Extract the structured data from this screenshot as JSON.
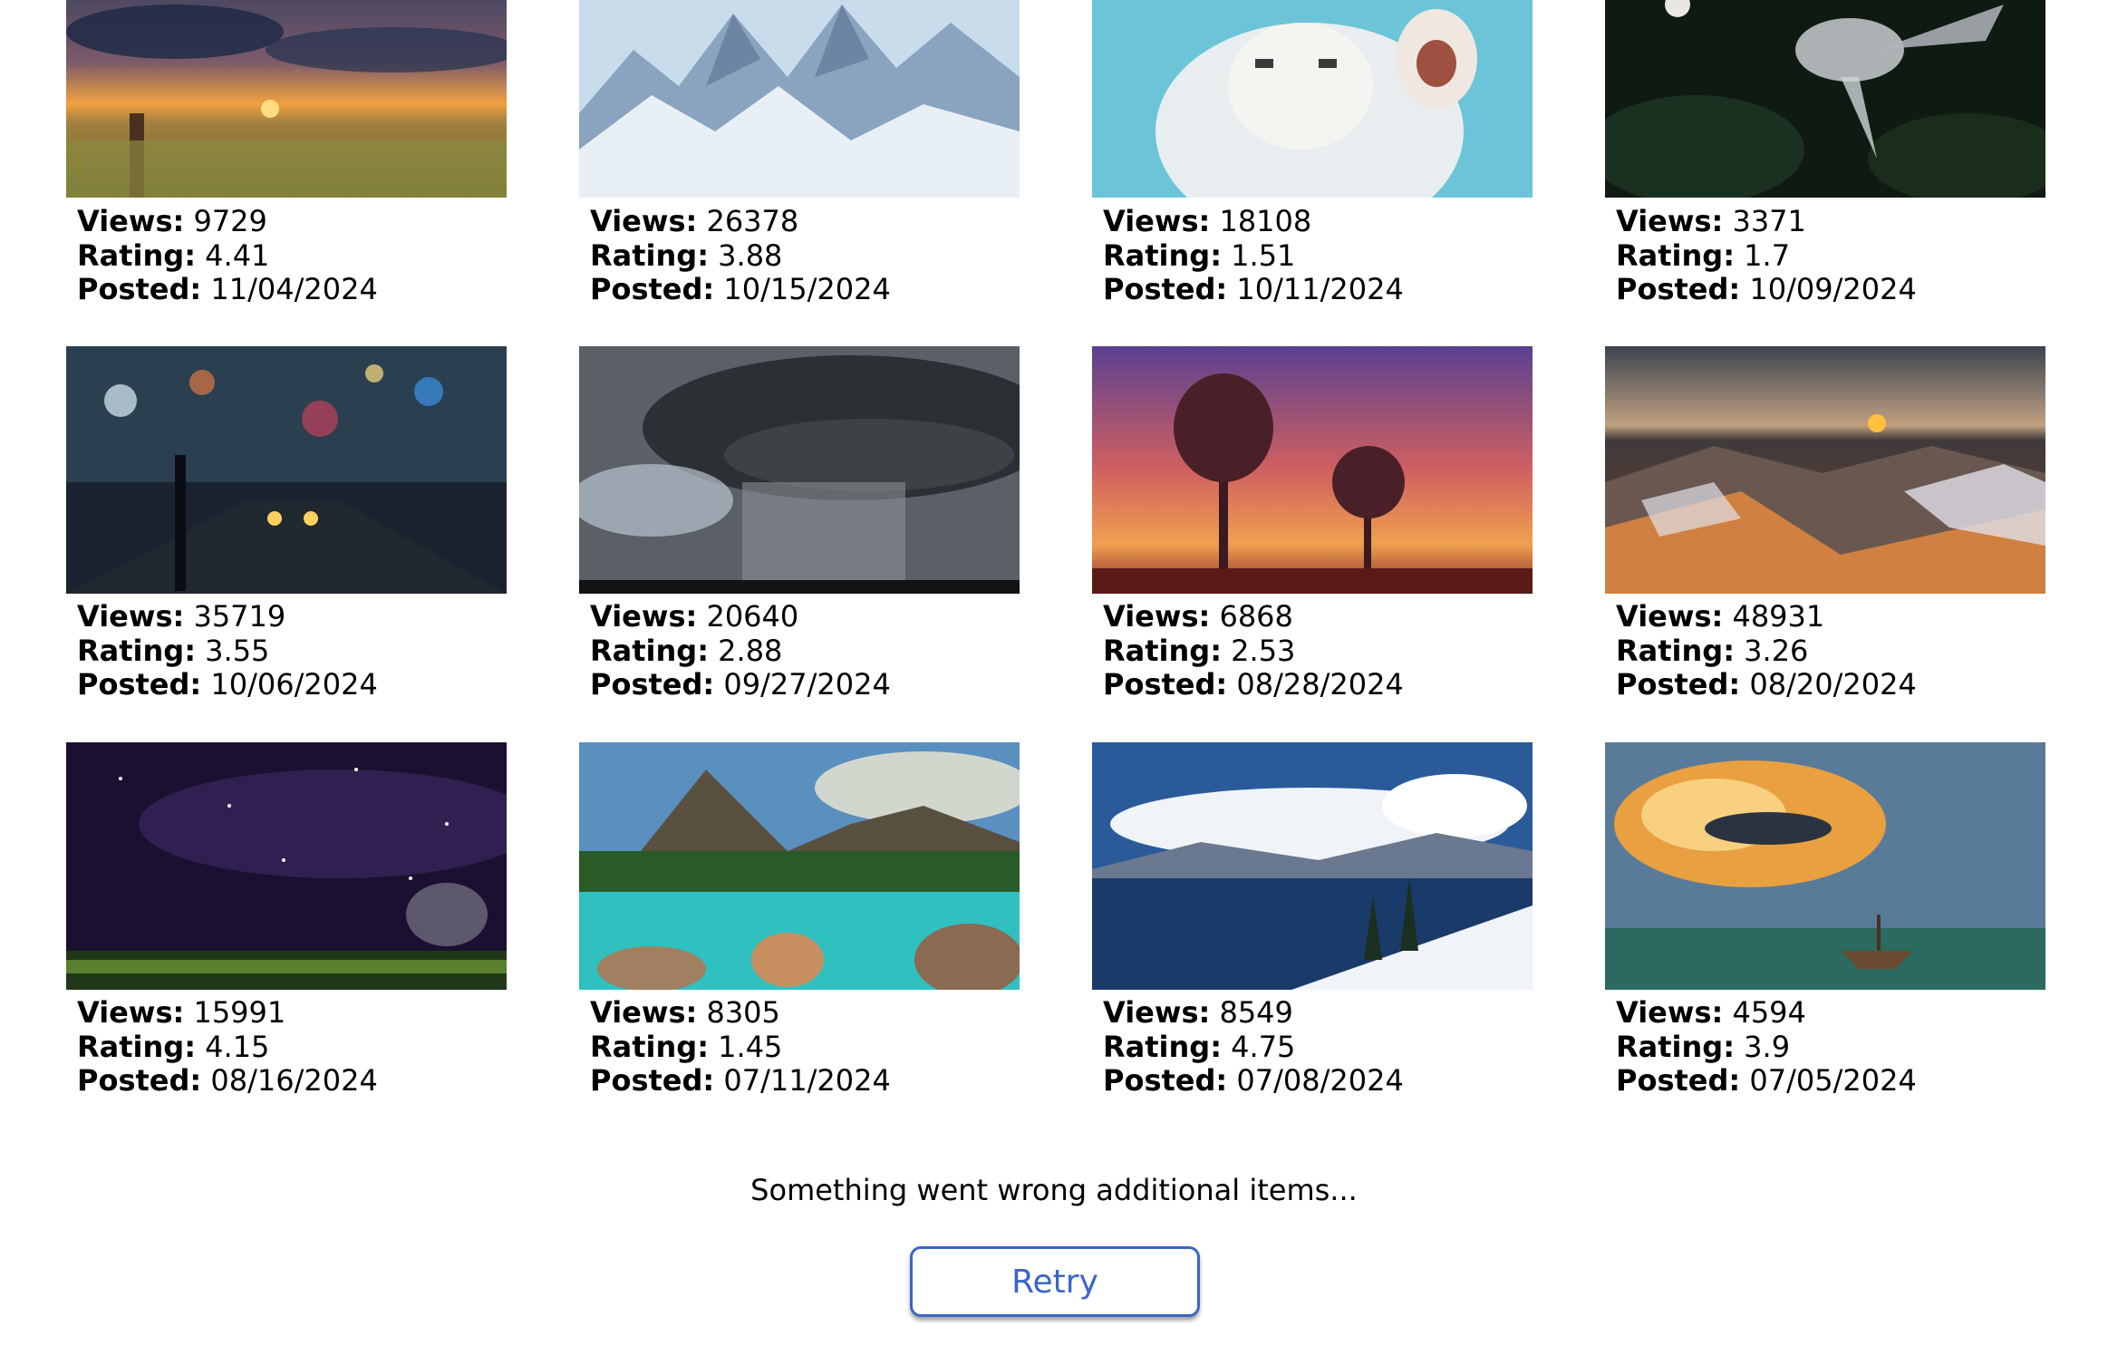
{
  "gallery": {
    "labels": {
      "views": "Views:",
      "rating": "Rating:",
      "posted": "Posted:"
    },
    "items": [
      {
        "views": "9729",
        "rating": "4.41",
        "posted": "11/04/2024",
        "scene": "prairie-sunset"
      },
      {
        "views": "26378",
        "rating": "3.88",
        "posted": "10/15/2024",
        "scene": "snowy-mountains"
      },
      {
        "views": "18108",
        "rating": "1.51",
        "posted": "10/11/2024",
        "scene": "white-tiger-underwater"
      },
      {
        "views": "3371",
        "rating": "1.7",
        "posted": "10/09/2024",
        "scene": "crystal-hummingbird"
      },
      {
        "views": "35719",
        "rating": "3.55",
        "posted": "10/06/2024",
        "scene": "city-street-night"
      },
      {
        "views": "20640",
        "rating": "2.88",
        "posted": "09/27/2024",
        "scene": "supercell-storm"
      },
      {
        "views": "6868",
        "rating": "2.53",
        "posted": "08/28/2024",
        "scene": "anime-sunset-trees"
      },
      {
        "views": "48931",
        "rating": "3.26",
        "posted": "08/20/2024",
        "scene": "canyon-sunrise"
      },
      {
        "views": "15991",
        "rating": "4.15",
        "posted": "08/16/2024",
        "scene": "night-sky-meadow"
      },
      {
        "views": "8305",
        "rating": "1.45",
        "posted": "07/11/2024",
        "scene": "turquoise-lake"
      },
      {
        "views": "8549",
        "rating": "4.75",
        "posted": "07/08/2024",
        "scene": "mountain-lake-reflection"
      },
      {
        "views": "4594",
        "rating": "3.9",
        "posted": "07/05/2024",
        "scene": "flying-whale-clouds"
      }
    ]
  },
  "status": {
    "message": "Something went wrong additional items..."
  },
  "retry": {
    "label": "Retry"
  },
  "colors": {
    "accent": "#3b66c4"
  }
}
